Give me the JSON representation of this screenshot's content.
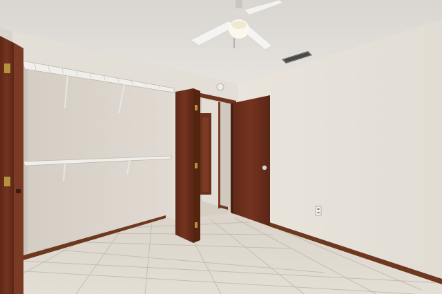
{
  "scene": {
    "ceiling_fan": "ceiling-fan-with-light",
    "colors": {
      "ceiling": "#dedbd6",
      "wall_left": "#e2ddd6",
      "wall_right": "#e8e3db",
      "closet_back": "#d8d2ca",
      "floor_tile": "#dcd6cc",
      "grout": "#c4bdb2",
      "door_wood": "#6b2f1c",
      "baseboard": "#6e3820"
    }
  }
}
